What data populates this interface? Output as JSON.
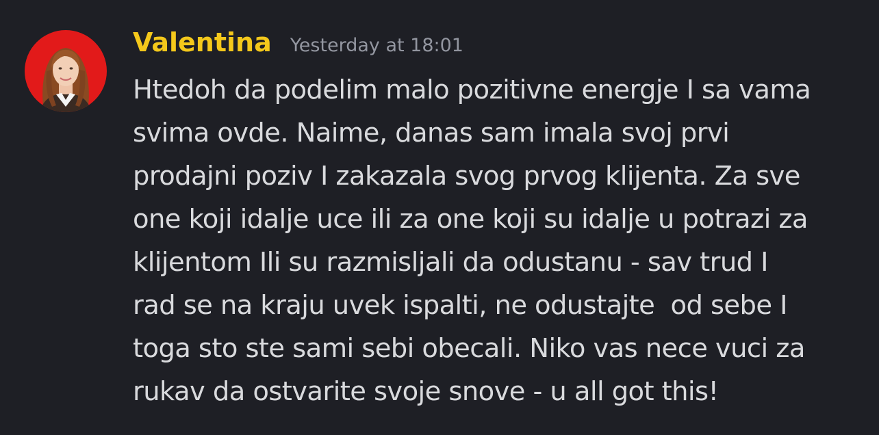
{
  "message": {
    "author": "Valentina",
    "timestamp": "Yesterday at 18:01",
    "lines": [
      "Htedoh da podelim malo pozitivne energje I sa vama",
      "svima ovde. Naime, danas sam imala svoj prvi",
      "prodajni poziv I zakazala svog prvog klijenta. Za sve",
      "one koji idalje uce ili za one koji su idalje u potrazi za",
      "klijentom Ili su razmisljali da odustanu - sav trud I",
      "rad se na kraju uvek ispalti, ne odustajte  od sebe I",
      "toga sto ste sami sebi obecali. Niko vas nece vuci za",
      "rukav da ostvarite svoje snove - u all got this!"
    ]
  },
  "colors": {
    "background": "#1e1f25",
    "username": "#f4c81b",
    "timestamp": "#9396a0",
    "text": "#d9dadd",
    "avatar_background": "#e21a1a"
  }
}
